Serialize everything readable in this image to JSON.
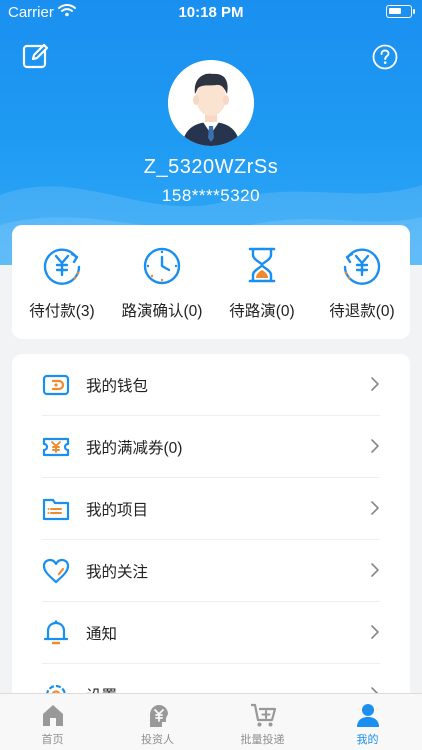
{
  "status_bar": {
    "carrier": "Carrier",
    "time": "10:18 PM"
  },
  "profile": {
    "username": "Z_5320WZrSs",
    "phone": "158****5320"
  },
  "orders": [
    {
      "label": "待付款(3)",
      "icon": "payment-pending-icon"
    },
    {
      "label": "路演确认(0)",
      "icon": "clock-icon"
    },
    {
      "label": "待路演(0)",
      "icon": "hourglass-icon"
    },
    {
      "label": "待退款(0)",
      "icon": "refund-icon"
    }
  ],
  "menu": [
    {
      "label": "我的钱包",
      "icon": "wallet-icon"
    },
    {
      "label": "我的满减券(0)",
      "icon": "coupon-icon"
    },
    {
      "label": "我的项目",
      "icon": "folder-icon"
    },
    {
      "label": "我的关注",
      "icon": "heart-icon"
    },
    {
      "label": "通知",
      "icon": "bell-icon"
    },
    {
      "label": "设置",
      "icon": "settings-icon"
    }
  ],
  "tabs": [
    {
      "label": "首页",
      "icon": "home-icon",
      "active": false
    },
    {
      "label": "投资人",
      "icon": "investor-icon",
      "active": false
    },
    {
      "label": "批量投递",
      "icon": "cart-icon",
      "active": false
    },
    {
      "label": "我的",
      "icon": "user-icon",
      "active": true
    }
  ],
  "colors": {
    "primary": "#1a8ff0",
    "accent_orange": "#f08a2c",
    "tab_inactive": "#8f8f8f"
  }
}
